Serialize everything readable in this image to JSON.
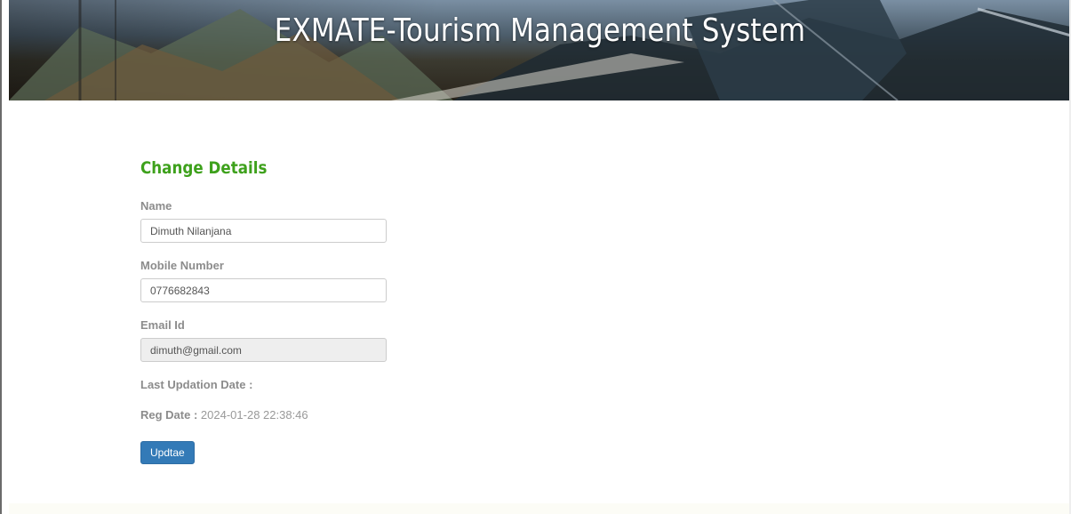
{
  "header": {
    "title": "EXMATE-Tourism Management System"
  },
  "form": {
    "title": "Change Details",
    "name_label": "Name",
    "name_value": "Dimuth Nilanjana",
    "mobile_label": "Mobile Number",
    "mobile_value": "0776682843",
    "email_label": "Email Id",
    "email_value": "dimuth@gmail.com",
    "last_update_label": "Last Updation Date :",
    "reg_date_label": "Reg Date :",
    "reg_date_value": "2024-01-28 22:38:46",
    "submit_label": "Updtae"
  },
  "colors": {
    "title_green": "#3ea11c",
    "button_blue": "#337ab7",
    "label_gray": "#8c8c8c"
  }
}
